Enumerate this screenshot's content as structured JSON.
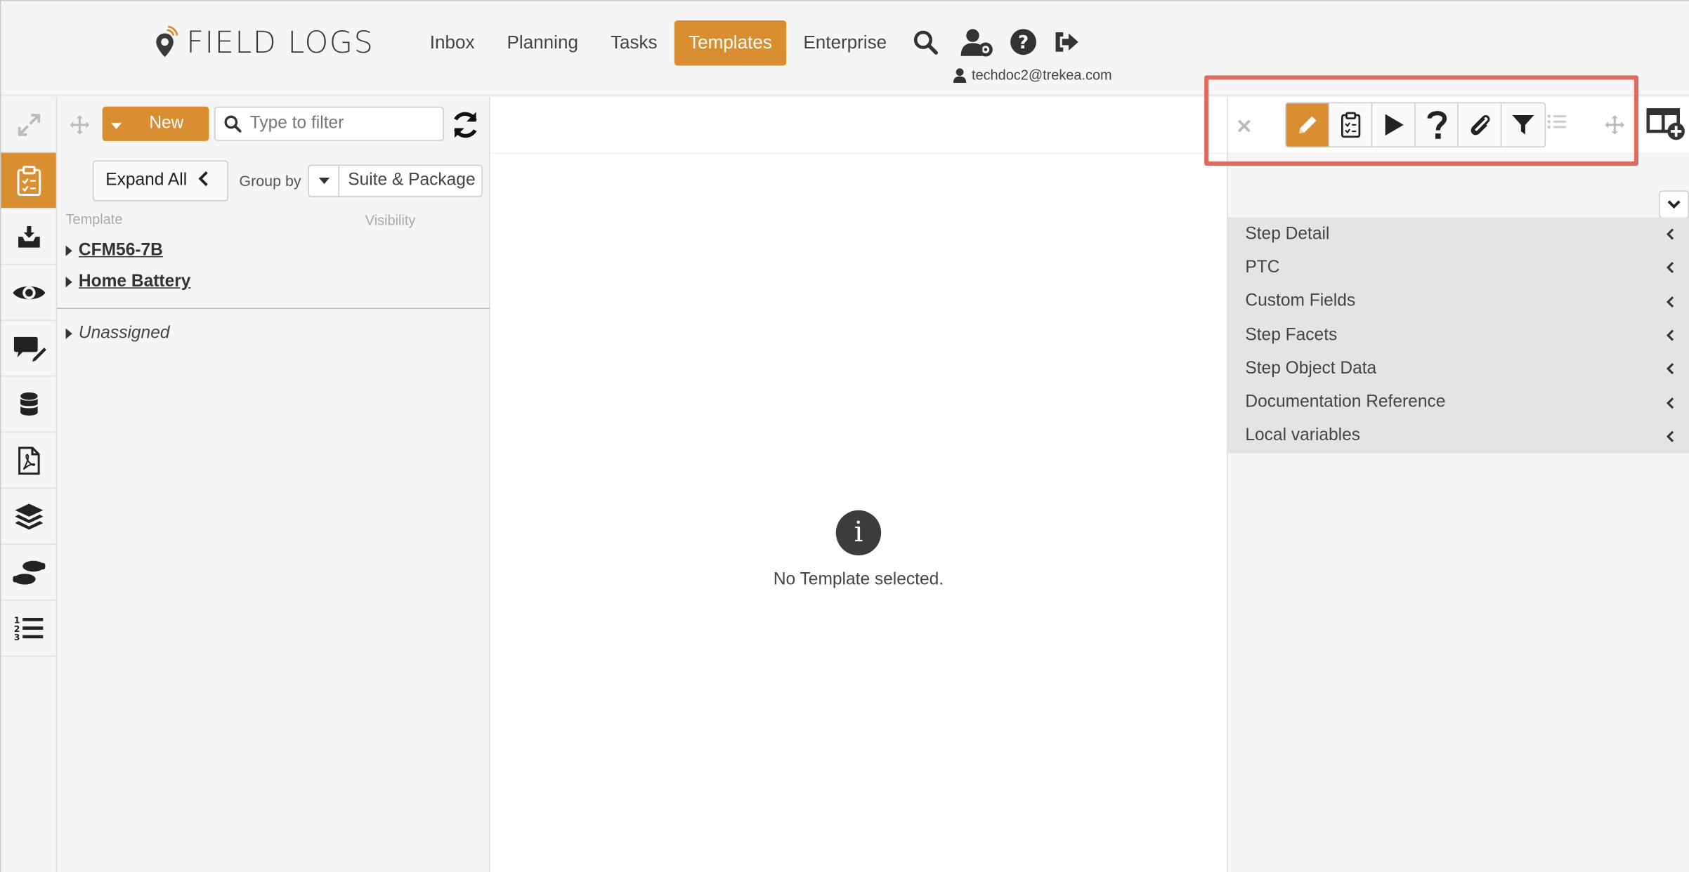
{
  "app": {
    "logo_text": "FIELD LOGS"
  },
  "nav": {
    "items": [
      {
        "label": "Inbox"
      },
      {
        "label": "Planning"
      },
      {
        "label": "Tasks"
      },
      {
        "label": "Templates",
        "active": true
      },
      {
        "label": "Enterprise"
      }
    ],
    "icons": [
      "search-icon",
      "user-settings-icon",
      "help-icon",
      "logout-icon"
    ]
  },
  "user": {
    "email": "techdoc2@trekea.com"
  },
  "rail": {
    "items": [
      "expand-icon",
      "checklist-icon",
      "inbox-download-icon",
      "eye-icon",
      "comment-edit-icon",
      "database-icon",
      "pdf-file-icon",
      "layers-icon",
      "footsteps-icon",
      "ordered-list-icon"
    ],
    "active": "checklist-icon"
  },
  "templates_panel": {
    "new_label": "New",
    "filter_placeholder": "Type to filter",
    "expand_all_label": "Expand All",
    "group_by_label": "Group by",
    "group_by_value": "Suite & Package",
    "columns": {
      "template": "Template",
      "visibility": "Visibility"
    },
    "tree": [
      {
        "label": "CFM56-7B"
      },
      {
        "label": "Home Battery"
      }
    ],
    "unassigned_label": "Unassigned"
  },
  "center": {
    "info_glyph": "i",
    "empty_message": "No Template selected."
  },
  "right_panel": {
    "toolbar_buttons": [
      "pencil-icon",
      "checklist-icon",
      "play-icon",
      "question-icon",
      "paperclip-icon",
      "filter-icon"
    ],
    "active_button": "pencil-icon",
    "sections": [
      {
        "label": "Step Detail"
      },
      {
        "label": "PTC"
      },
      {
        "label": "Custom Fields"
      },
      {
        "label": "Step Facets"
      },
      {
        "label": "Step Object Data"
      },
      {
        "label": "Documentation Reference"
      },
      {
        "label": "Local variables"
      }
    ]
  },
  "colors": {
    "accent": "#d98e32",
    "highlight_border": "#e06a5e"
  }
}
